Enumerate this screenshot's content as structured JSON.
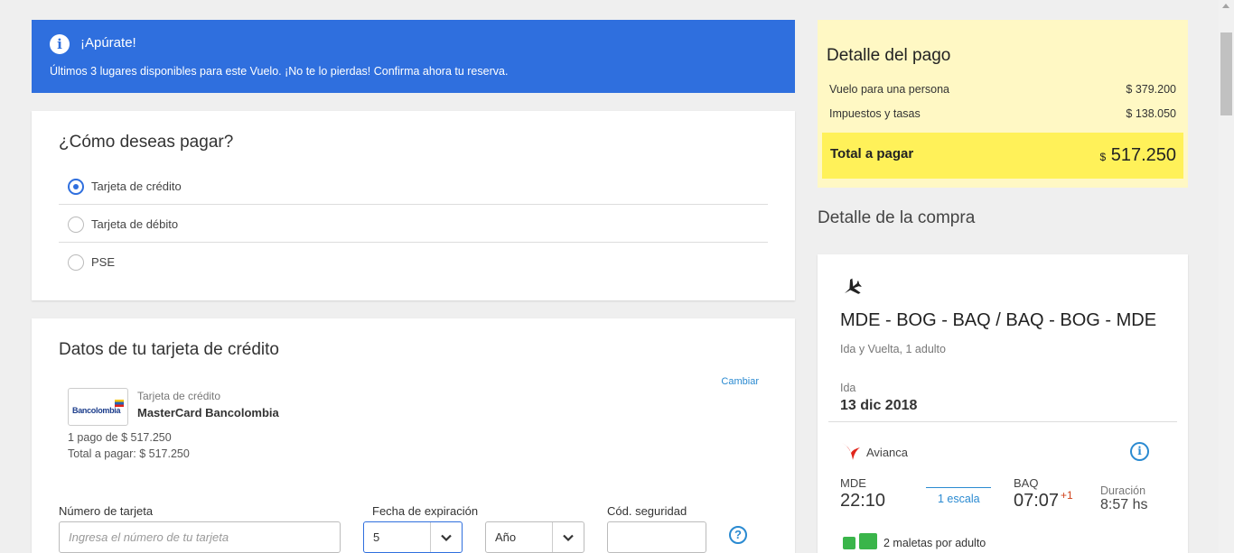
{
  "alert": {
    "title": "¡Apúrate!",
    "text": "Últimos 3 lugares disponibles para este Vuelo. ¡No te lo pierdas! Confirma ahora tu reserva.",
    "icon": "info-icon"
  },
  "payment_method": {
    "title": "¿Cómo deseas pagar?",
    "options": [
      {
        "label": "Tarjeta de crédito",
        "selected": true
      },
      {
        "label": "Tarjeta de débito",
        "selected": false
      },
      {
        "label": "PSE",
        "selected": false
      }
    ]
  },
  "credit_card": {
    "title": "Datos de tu tarjeta de crédito",
    "change_label": "Cambiar",
    "bank_logo_text": "Bancolombia",
    "card_kind": "Tarjeta de crédito",
    "card_name": "MasterCard Bancolombia",
    "installments": "1 pago de $ 517.250",
    "total": "Total a pagar: $ 517.250",
    "number_label": "Número de tarjeta",
    "number_placeholder": "Ingresa el número de tu tarjeta",
    "expiry_label": "Fecha de expiración",
    "expiry_month": "5",
    "expiry_year": "Año",
    "security_label": "Cód. seguridad",
    "help_icon": "question-icon"
  },
  "summary": {
    "title": "Detalle del pago",
    "rows": [
      {
        "label": "Vuelo para una persona",
        "value": "$ 379.200"
      },
      {
        "label": "Impuestos y tasas",
        "value": "$ 138.050"
      }
    ],
    "total_label": "Total a pagar",
    "total_currency": "$",
    "total_value": "517.250",
    "background_color": "#fff8c4",
    "total_color": "#fff159"
  },
  "purchase": {
    "title": "Detalle de la compra",
    "route": "MDE - BOG - BAQ / BAQ - BOG - MDE",
    "trip_type": "Ida y Vuelta, 1 adulto",
    "leg_label": "Ida",
    "leg_date": "13 dic 2018",
    "airline": "Avianca",
    "origin_code": "MDE",
    "origin_time": "22:10",
    "stops": "1 escala",
    "dest_code": "BAQ",
    "dest_time": "07:07",
    "day_offset": "+1",
    "duration_label": "Duración",
    "duration_value": "8:57 hs",
    "baggage": "2 maletas por adulto"
  },
  "colors": {
    "accent": "#2f6fde",
    "link": "#2a8ad1",
    "baggage_green": "#3ab54a"
  }
}
